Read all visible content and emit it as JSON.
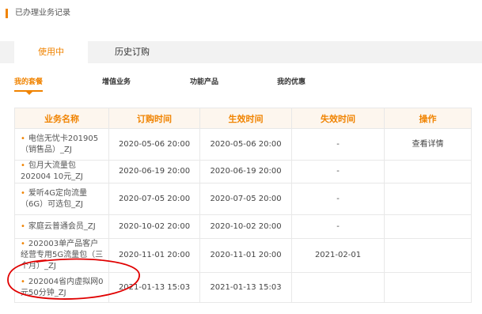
{
  "section": {
    "title": "已办理业务记录"
  },
  "tabs": [
    {
      "label": "使用中"
    },
    {
      "label": "历史订购"
    }
  ],
  "subtabs": [
    {
      "label": "我的套餐"
    },
    {
      "label": "增值业务"
    },
    {
      "label": "功能产品"
    },
    {
      "label": "我的优惠"
    }
  ],
  "table": {
    "headers": [
      "业务名称",
      "订购时间",
      "生效时间",
      "失效时间",
      "操作"
    ],
    "rows": [
      {
        "bullet": "•",
        "name": "电信无忧卡201905（销售品）_ZJ",
        "order_time": "2020-05-06 20:00",
        "effective_time": "2020-05-06 20:00",
        "expire_time": "-",
        "action": "查看详情"
      },
      {
        "bullet": "•",
        "name": "包月大流量包202004 10元_ZJ",
        "order_time": "2020-06-19 20:00",
        "effective_time": "2020-06-19 20:00",
        "expire_time": "-",
        "action": ""
      },
      {
        "bullet": "•",
        "name": "爱听4G定向流量（6G）可选包_ZJ",
        "order_time": "2020-07-05 20:00",
        "effective_time": "2020-07-05 20:00",
        "expire_time": "-",
        "action": ""
      },
      {
        "bullet": "•",
        "name": "家庭云普通会员_ZJ",
        "order_time": "2020-10-02 20:00",
        "effective_time": "2020-10-02 20:00",
        "expire_time": "-",
        "action": ""
      },
      {
        "bullet": "•",
        "name": "202003单产品客户经营专用5G流量包（三个月）_ZJ",
        "order_time": "2020-11-01 20:00",
        "effective_time": "2020-11-01 20:00",
        "expire_time": "2021-02-01",
        "action": ""
      },
      {
        "bullet": "•",
        "name": "202004省内虚拟网0元50分钟_ZJ",
        "order_time": "2021-01-13 15:03",
        "effective_time": "2021-01-13 15:03",
        "expire_time": "",
        "action": ""
      }
    ]
  },
  "colors": {
    "accent": "#f08300",
    "annotation": "#e00000"
  }
}
